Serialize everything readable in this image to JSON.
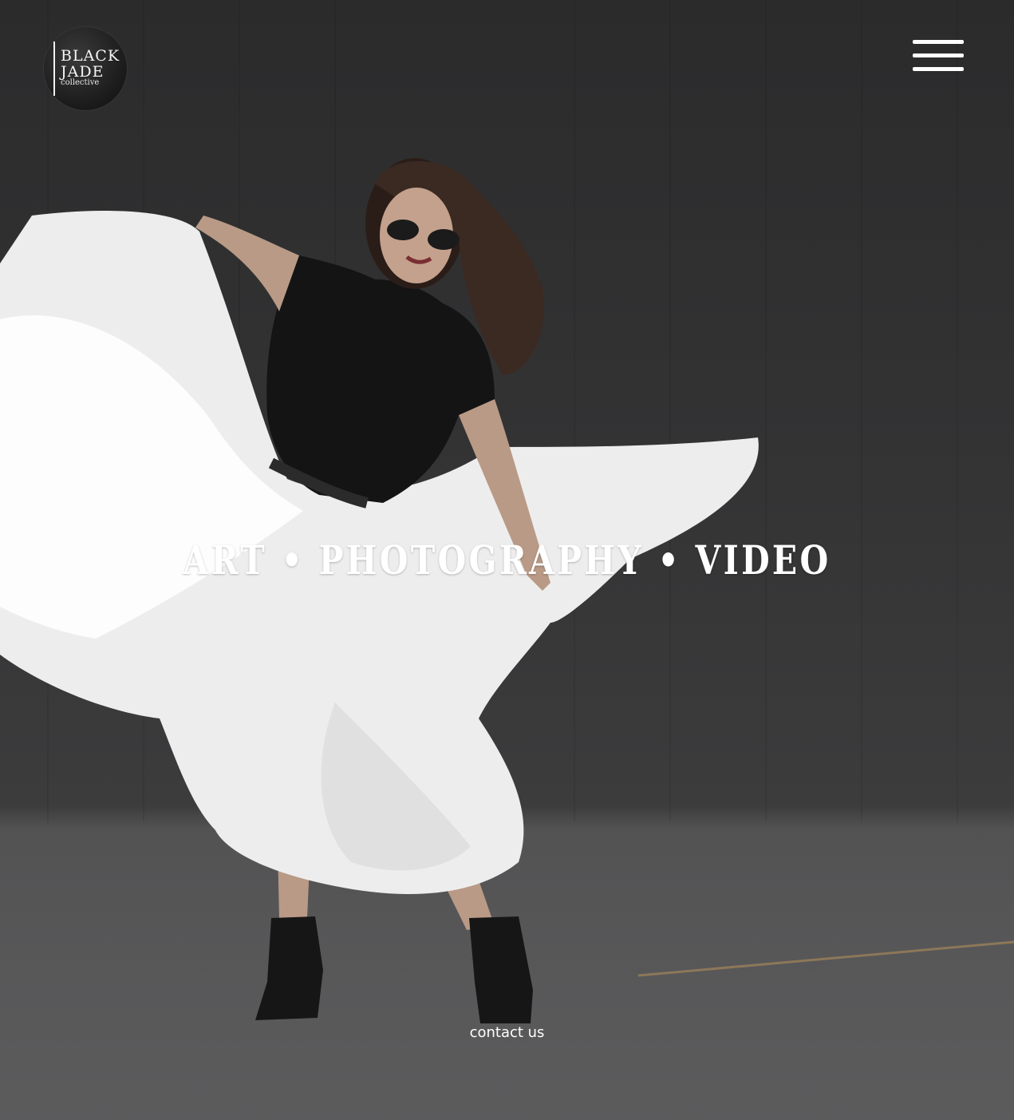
{
  "logo": {
    "line1": "BLACK",
    "line2": "JADE",
    "line3": "collective"
  },
  "header": {
    "menu_icon": "hamburger-menu-icon"
  },
  "hero": {
    "image": "woman-dancing-with-white-skirt-photo",
    "tagline": "ART • PHOTOGRAPHY • VIDEO"
  },
  "footer": {
    "contact_label": "contact us"
  },
  "colors": {
    "text": "#ffffff",
    "background": "#2b2b2c",
    "pavement": "#5c5c5d"
  }
}
